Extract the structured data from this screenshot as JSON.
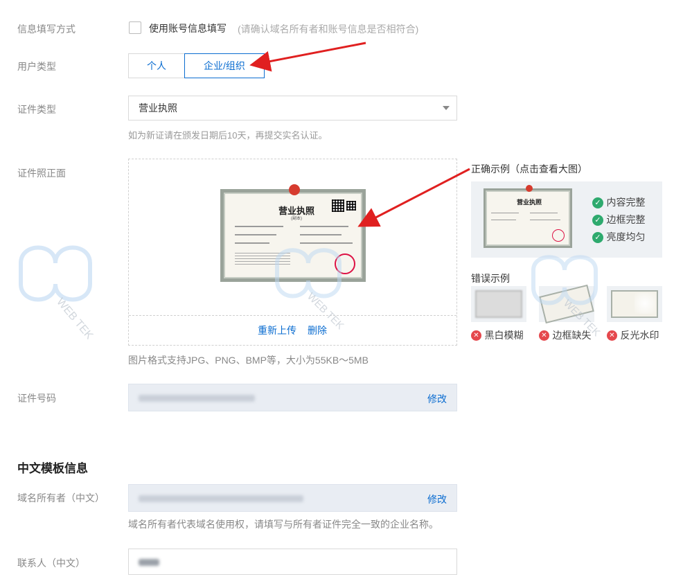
{
  "form": {
    "fill_method": {
      "label": "信息填写方式",
      "checkbox_label": "使用账号信息填写",
      "checkbox_hint": "(请确认域名所有者和账号信息是否相符合)"
    },
    "user_type": {
      "label": "用户类型",
      "options": [
        "个人",
        "企业/组织"
      ],
      "selected": "企业/组织"
    },
    "cert_type": {
      "label": "证件类型",
      "value": "营业执照",
      "hint": "如为新证请在颁发日期后10天，再提交实名认证。"
    },
    "cert_front": {
      "label": "证件照正面",
      "reupload_label": "重新上传",
      "delete_label": "删除",
      "format_hint": "图片格式支持JPG、PNG、BMP等，大小为55KB～5MB",
      "license_title": "营业执照",
      "license_subtitle": "(副本)"
    },
    "cert_number": {
      "label": "证件号码",
      "edit_label": "修改"
    }
  },
  "examples": {
    "correct_title": "正确示例（点击查看大图）",
    "correct_items": [
      "内容完整",
      "边框完整",
      "亮度均匀"
    ],
    "wrong_title": "错误示例",
    "wrong_items": [
      "黑白模糊",
      "边框缺失",
      "反光水印"
    ]
  },
  "template_section": {
    "title": "中文模板信息",
    "owner": {
      "label": "域名所有者（中文）",
      "edit_label": "修改",
      "hint": "域名所有者代表域名使用权，请填写与所有者证件完全一致的企业名称。"
    },
    "contact": {
      "label": "联系人（中文）"
    }
  },
  "watermark": {
    "text_left": "WEB TEK",
    "text_mid": "WEB TEK",
    "text_right": "WEB TEK"
  },
  "colors": {
    "accent": "#0a6cd0",
    "arrow": "#e02020",
    "ok": "#2eaa6e",
    "error": "#e5484d"
  }
}
